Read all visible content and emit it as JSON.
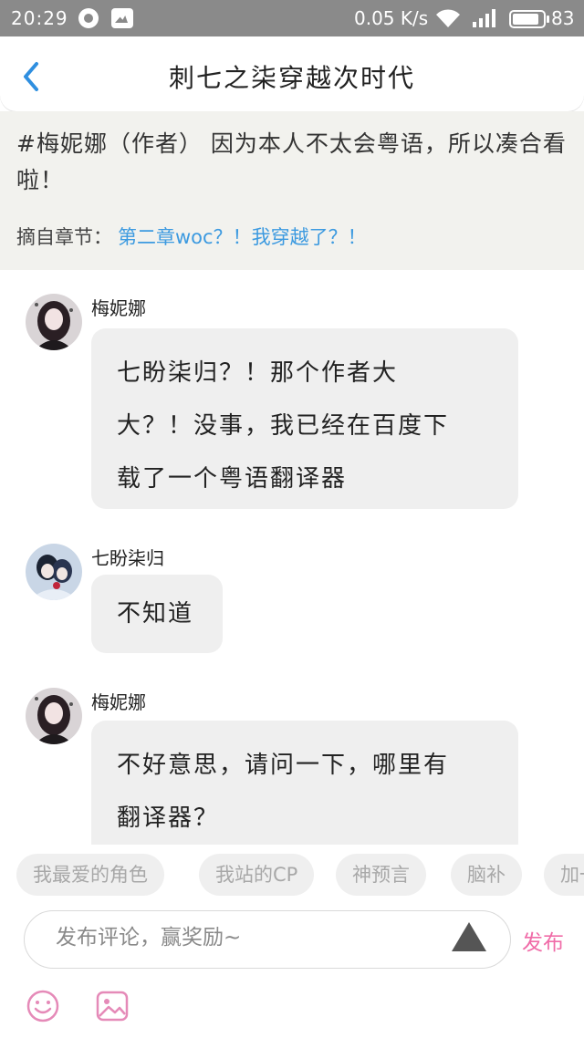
{
  "status_bar": {
    "time": "20:29",
    "speed": "0.05 K/s",
    "battery": "83"
  },
  "header": {
    "title": "刺七之柒穿越次时代",
    "back_icon": "chevron-left-icon"
  },
  "quote": {
    "text": "#梅妮娜（作者） 因为本人不太会粤语，所以凑合看啦！",
    "chapter_label": "摘自章节：",
    "chapter_link": "第二章woc？！我穿越了？！"
  },
  "comments": [
    {
      "author": "梅妮娜",
      "lines": [
        "七盼柒归？！那个作者大",
        "大？！没事，我已经在百度下",
        "载了一个粤语翻译器"
      ]
    },
    {
      "author": "七盼柒归",
      "lines": [
        "不知道"
      ]
    },
    {
      "author": "梅妮娜",
      "lines": [
        "不好意思，请问一下，哪里有",
        "翻译器？"
      ]
    }
  ],
  "tags": [
    "我最爱的角色",
    "我站的CP",
    "神预言",
    "脑补",
    "加一"
  ],
  "composer": {
    "placeholder": "发布评论，赢奖励~",
    "publish_label": "发布"
  },
  "colors": {
    "accent_pink": "#f06ca8",
    "link_blue": "#3c9ae0",
    "back_blue": "#2f8fe0"
  }
}
